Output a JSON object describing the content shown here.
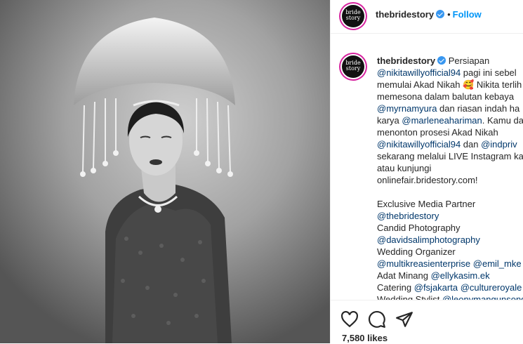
{
  "post": {
    "username": "thebridestory",
    "avatar_text_1": "bride",
    "avatar_text_2": "story",
    "follow_label": "Follow",
    "dot": "•"
  },
  "caption": {
    "lines": [
      {
        "parts": [
          {
            "t": "Persiapan",
            "c": "plain"
          }
        ]
      },
      {
        "parts": [
          {
            "t": "@nikitawillyofficial94",
            "c": "blue"
          },
          {
            "t": " pagi ini sebel",
            "c": "plain"
          }
        ]
      },
      {
        "parts": [
          {
            "t": "memulai Akad Nikah 🥰 Nikita terlih",
            "c": "plain"
          }
        ]
      },
      {
        "parts": [
          {
            "t": "memesona dalam balutan kebaya",
            "c": "plain"
          }
        ]
      },
      {
        "parts": [
          {
            "t": "@myrnamyura",
            "c": "blue"
          },
          {
            "t": " dan riasan indah ha",
            "c": "plain"
          }
        ]
      },
      {
        "parts": [
          {
            "t": "karya ",
            "c": "plain"
          },
          {
            "t": "@marleneahariman",
            "c": "blue"
          },
          {
            "t": ". Kamu da",
            "c": "plain"
          }
        ]
      },
      {
        "parts": [
          {
            "t": "menonton prosesi Akad Nikah",
            "c": "plain"
          }
        ]
      },
      {
        "parts": [
          {
            "t": "@nikitawillyofficial94",
            "c": "blue"
          },
          {
            "t": " dan ",
            "c": "plain"
          },
          {
            "t": "@indpriv",
            "c": "blue"
          }
        ]
      },
      {
        "parts": [
          {
            "t": "sekarang melalui LIVE Instagram ka",
            "c": "plain"
          }
        ]
      },
      {
        "parts": [
          {
            "t": "atau kunjungi",
            "c": "plain"
          }
        ]
      },
      {
        "parts": [
          {
            "t": "onlinefair.bridestory.com!",
            "c": "plain"
          }
        ]
      },
      {
        "parts": []
      },
      {
        "parts": [
          {
            "t": "Exclusive Media Partner",
            "c": "plain"
          }
        ]
      },
      {
        "parts": [
          {
            "t": "@thebridestory",
            "c": "blue"
          }
        ]
      },
      {
        "parts": [
          {
            "t": "Candid Photography",
            "c": "plain"
          }
        ]
      },
      {
        "parts": [
          {
            "t": "@davidsalimphotography",
            "c": "blue"
          }
        ]
      },
      {
        "parts": [
          {
            "t": "Wedding Organizer",
            "c": "plain"
          }
        ]
      },
      {
        "parts": [
          {
            "t": "@multikreasienterprise",
            "c": "blue"
          },
          {
            "t": " ",
            "c": "plain"
          },
          {
            "t": "@emil_mke",
            "c": "blue"
          }
        ]
      },
      {
        "parts": [
          {
            "t": "Adat Minang ",
            "c": "plain"
          },
          {
            "t": "@ellykasim.ek",
            "c": "blue"
          }
        ]
      },
      {
        "parts": [
          {
            "t": "Catering ",
            "c": "plain"
          },
          {
            "t": "@fsjakarta",
            "c": "blue"
          },
          {
            "t": " ",
            "c": "plain"
          },
          {
            "t": "@cultureroyale",
            "c": "blue"
          }
        ]
      },
      {
        "parts": [
          {
            "t": "Wedding Stylist ",
            "c": "plain"
          },
          {
            "t": "@leonymangunsong",
            "c": "blue"
          }
        ]
      }
    ]
  },
  "actions": {
    "like_icon": "heart-icon",
    "comment_icon": "comment-icon",
    "share_icon": "share-icon",
    "likes_text": "7,580 likes"
  },
  "colors": {
    "follow_blue": "#0095f6",
    "verified_blue": "#3897f0",
    "mention_blue": "#00376b"
  }
}
